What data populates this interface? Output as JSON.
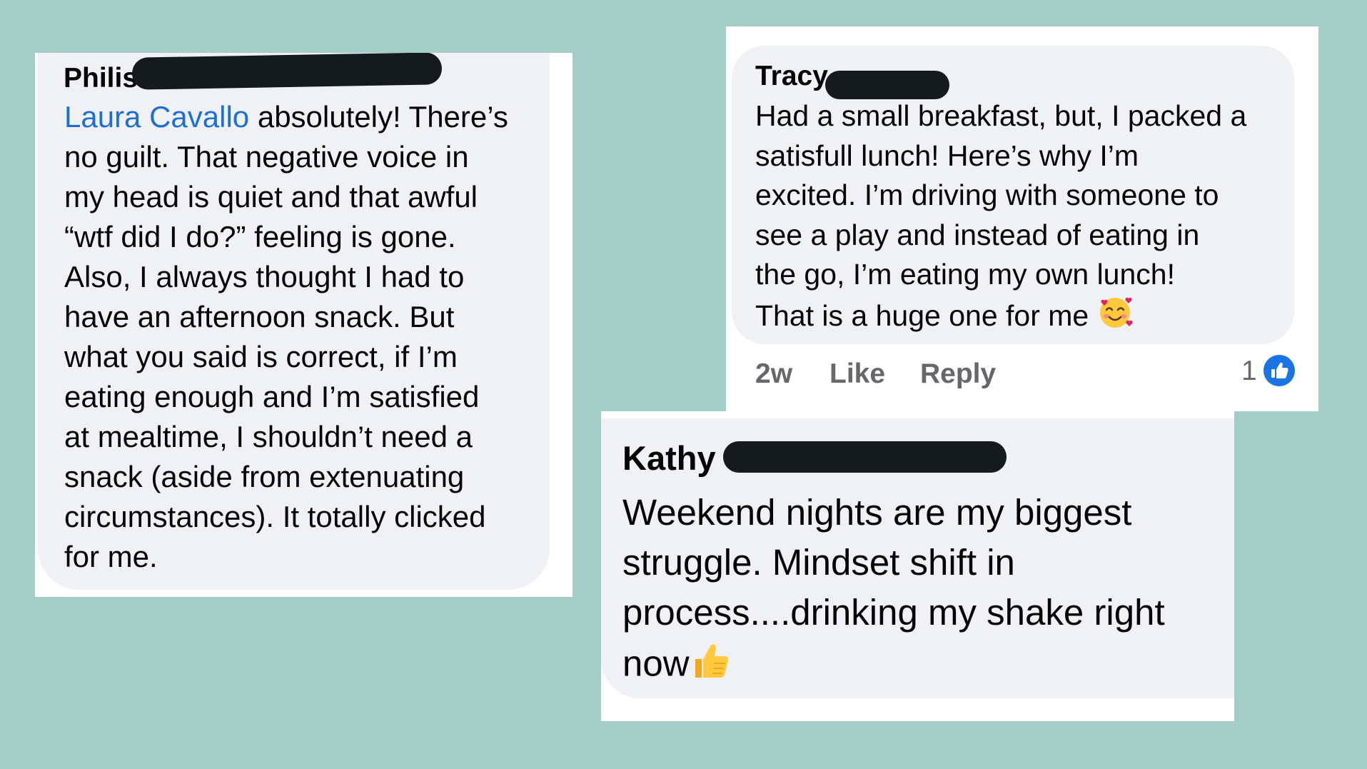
{
  "comments": [
    {
      "name": "Philis",
      "mention": "Laura Cavallo",
      "text": " absolutely! There’s\nno guilt. That negative voice in\nmy head is quiet and that awful\n“wtf did I do?” feeling is gone.\nAlso, I always thought I had to\nhave an afternoon snack. But\nwhat you said is correct, if I’m\neating enough and I’m satisfied\nat mealtime, I shouldn’t need a\nsnack (aside from extenuating\ncircumstances). It totally clicked\nfor me."
    },
    {
      "name": "Tracy",
      "text": "Had a small breakfast, but, I packed a\nsatisfull lunch!  Here’s why I’m\nexcited.  I’m driving with someone to\nsee a play and instead of eating in\nthe go, I’m eating my own lunch!\nThat is a huge one for me ",
      "emoji": "smiling-face-with-hearts",
      "time": "2w",
      "like_label": "Like",
      "reply_label": "Reply",
      "reaction_count": "1",
      "reaction_icon": "thumbs-up-icon"
    },
    {
      "name": "Kathy",
      "text": "Weekend nights are my biggest\nstruggle. Mindset shift in\nprocess....drinking my shake right\nnow",
      "emoji": "thumbs-up-emoji"
    }
  ],
  "colors": {
    "background": "#a4cdc8",
    "bubble": "#f0f1f5",
    "mention": "#1d6fd6",
    "redaction": "#151a1c",
    "like_badge": "#1b74e4"
  }
}
